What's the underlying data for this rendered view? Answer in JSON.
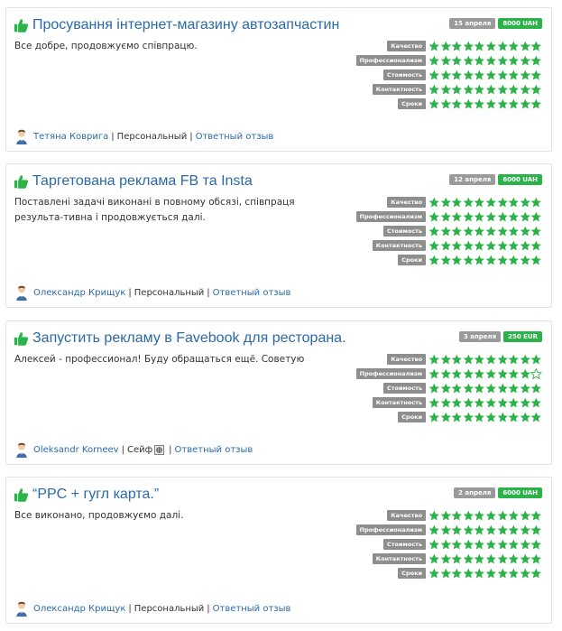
{
  "reviews": [
    {
      "title": "Просування інтернет-магазину автозапчастин",
      "date": "15 апреля",
      "price": "8000 UAH",
      "text": "Все добре, продовжуємо співпрацю.",
      "ratings": [
        {
          "label": "Качество",
          "value": 10
        },
        {
          "label": "Профессионализм",
          "value": 10
        },
        {
          "label": "Стоимость",
          "value": 10
        },
        {
          "label": "Контактность",
          "value": 10
        },
        {
          "label": "Сроки",
          "value": 10
        }
      ],
      "author": "Тетяна Коврига",
      "type": "Персональный",
      "reply": "Ответный отзыв"
    },
    {
      "title": "Таргетована реклама FB та Insta",
      "date": "12 апреля",
      "price": "6000 UAH",
      "text": "Поставлені задачі виконані в повному обсязі, співпраця результа-тивна і продовжується далі.",
      "ratings": [
        {
          "label": "Качество",
          "value": 10
        },
        {
          "label": "Профессионализм",
          "value": 10
        },
        {
          "label": "Стоимость",
          "value": 10
        },
        {
          "label": "Контактность",
          "value": 10
        },
        {
          "label": "Сроки",
          "value": 10
        }
      ],
      "author": "Олександр Крищук",
      "type": "Персональный",
      "reply": "Ответный отзыв"
    },
    {
      "title": "Запустить рекламу в Favebook для ресторана.",
      "date": "3 апреля",
      "price": "250 EUR",
      "text": "Алексей - профессионал! Буду обращаться ещё. Советую",
      "ratings": [
        {
          "label": "Качество",
          "value": 10
        },
        {
          "label": "Профессионализм",
          "value": 9
        },
        {
          "label": "Стоимость",
          "value": 10
        },
        {
          "label": "Контактность",
          "value": 10
        },
        {
          "label": "Сроки",
          "value": 10
        }
      ],
      "author": "Oleksandr Korneev",
      "type": "Сейф",
      "safe_icon": true,
      "reply": "Ответный отзыв"
    },
    {
      "title": "“PPC + гугл карта.”",
      "date": "2 апреля",
      "price": "6000 UAH",
      "text": "Все виконано, продовжуємо далі.",
      "ratings": [
        {
          "label": "Качество",
          "value": 10
        },
        {
          "label": "Профессионализм",
          "value": 10
        },
        {
          "label": "Стоимость",
          "value": 10
        },
        {
          "label": "Контактность",
          "value": 10
        },
        {
          "label": "Сроки",
          "value": 10
        }
      ],
      "author": "Олександр Крищук",
      "type": "Персональный",
      "reply": "Ответный отзыв"
    }
  ],
  "rating_max": 10,
  "icons": {
    "thumb": "thumbs-up-icon",
    "avatar": "user-avatar-icon",
    "star": "star-icon",
    "safe": "safe-icon"
  },
  "colors": {
    "title": "#2a6aa8",
    "star": "#2bb34a",
    "price_badge": "#2bb34a",
    "date_badge": "#9a9a9a",
    "label_badge": "#8e8e8e"
  }
}
